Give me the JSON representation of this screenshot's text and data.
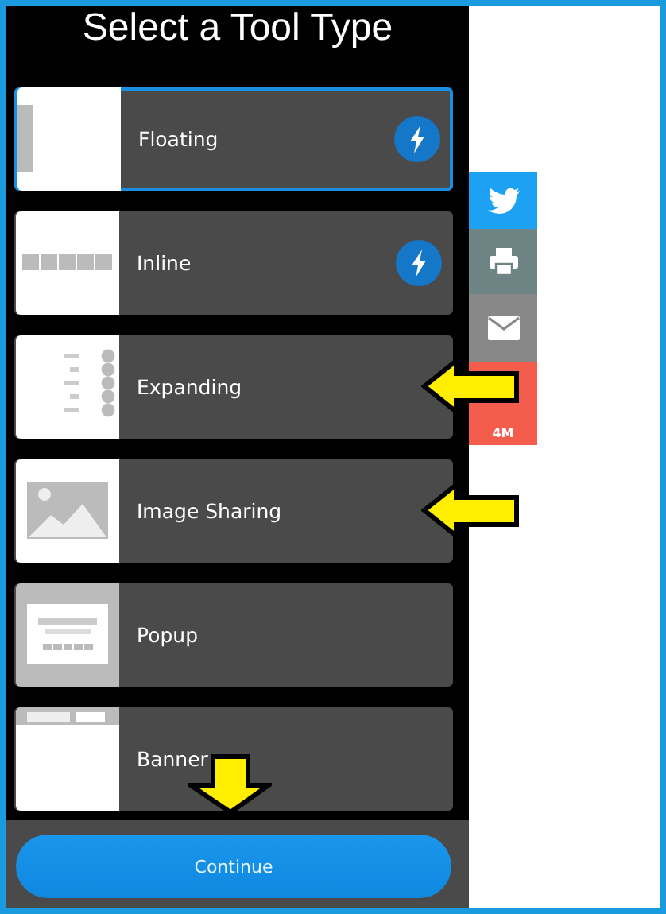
{
  "title": "Select a Tool Type",
  "tools": [
    {
      "label": "Floating",
      "kind": "floating",
      "selected": true,
      "instant": true,
      "pointed": false
    },
    {
      "label": "Inline",
      "kind": "inline",
      "selected": false,
      "instant": true,
      "pointed": false
    },
    {
      "label": "Expanding",
      "kind": "expanding",
      "selected": false,
      "instant": false,
      "pointed": true
    },
    {
      "label": "Image Sharing",
      "kind": "image",
      "selected": false,
      "instant": false,
      "pointed": true
    },
    {
      "label": "Popup",
      "kind": "popup",
      "selected": false,
      "instant": false,
      "pointed": false
    },
    {
      "label": "Banner",
      "kind": "banner",
      "selected": false,
      "instant": false,
      "pointed": false
    }
  ],
  "share_bar": [
    {
      "kind": "twitter"
    },
    {
      "kind": "print"
    },
    {
      "kind": "email"
    },
    {
      "kind": "count",
      "count": "4M"
    }
  ],
  "continue_button": {
    "label": "Continue",
    "pointed": true
  }
}
